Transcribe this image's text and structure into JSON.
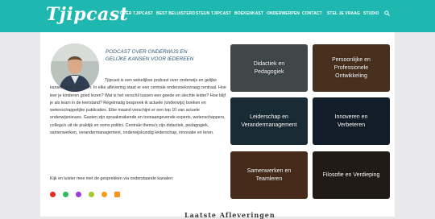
{
  "header": {
    "logo_text": "Tjipcast",
    "brand_color": "#1fb8b0",
    "nav": [
      {
        "label": "OVER TJIPCAST"
      },
      {
        "label": "BEST BELUISTERD"
      },
      {
        "label": "STEUN TJIPCAST"
      },
      {
        "label": "BOEKENKAST"
      },
      {
        "label": "ONDERWERPEN"
      },
      {
        "label": "CONTACT"
      },
      {
        "label": "STEL JE VRAAG"
      },
      {
        "label": "STUDIO"
      }
    ],
    "search_icon": "search-icon"
  },
  "intro": {
    "headline_1": "PODCAST OVER ONDERWIJS EN",
    "headline_2": "GELIJKE KANSEN VOOR IEDEREEN",
    "body": "Tjipcast is een wekelijkse podcast over onderwijs en gelijke kansen voor iedereen. In elke aflevering staat er een centrale onderzoeksvraag centraal. Hoe leer je kinderen goed lezen? Wat is het verschil tussen een goede en slechte leider? Hoe blijf je als team in de leerstand? Regelmatig bespreek ik actuele (onderwijs) boeken en wetenschappelijke publicaties. Elke maand verschijnt er een top 10 van actuele onderwijsnieuws. Gasten zijn spraakmakende en toonaangevende experts, wetenschappers, collega's uit de praktijk en soms politici. Centrale thema's zijn didactiek, pedagogiek, samenwerken, verandermanagement, onderwijskundig leiderschap, innovatie en leren.",
    "listen": "Kijk en luister mee met de gesprekken via onderstaande kanalen:",
    "socials": [
      {
        "icon": "youtube-icon",
        "color": "#e02b20"
      },
      {
        "icon": "spotify-icon",
        "color": "#2ebd59"
      },
      {
        "icon": "podcast-icon",
        "color": "#9b3dd6"
      },
      {
        "icon": "android-icon",
        "color": "#a4c639"
      },
      {
        "icon": "stitcher-icon",
        "color": "#f59b1c"
      },
      {
        "icon": "rss-icon",
        "color": "#f7931e"
      }
    ]
  },
  "tiles": [
    {
      "label_1": "Didactiek en",
      "label_2": "Pedagogiek",
      "color": "#6f7a7c"
    },
    {
      "label_1": "Persoonlijke en",
      "label_2": "Professionele",
      "label_3": "Ontwikkeling",
      "color": "#7c5436"
    },
    {
      "label_1": "Leiderschap en",
      "label_2": "Verandermanagement",
      "color": "#2c4b5c"
    },
    {
      "label_1": "Innoveren en",
      "label_2": "Verbeteren",
      "color": "#1e3346"
    },
    {
      "label_1": "Samenwerken en",
      "label_2": "Teamleren",
      "color": "#7a4a2e"
    },
    {
      "label_1": "Filosofie en Verdieping",
      "color": "#3a2e28"
    }
  ],
  "section": {
    "title": "Laatste Afleveringen"
  }
}
